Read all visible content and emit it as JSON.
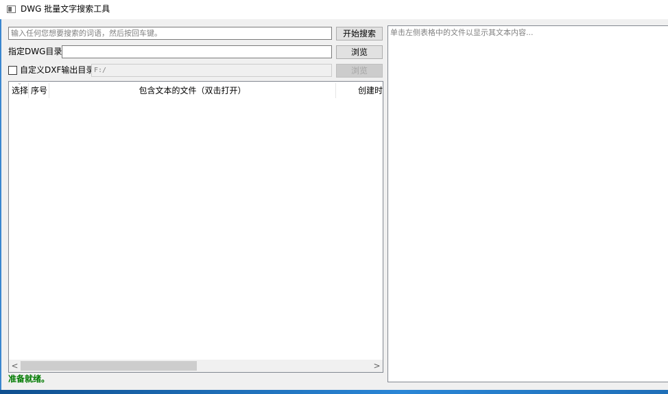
{
  "window": {
    "title": "DWG 批量文字搜索工具"
  },
  "search": {
    "placeholder": "输入任何您想要搜索的词语，然后按回车键。",
    "button_label": "开始搜索"
  },
  "dwg_dir": {
    "label": "指定DWG目录:",
    "value": "",
    "browse_label": "浏览"
  },
  "dxf_dir": {
    "checkbox_label": "自定义DXF输出目录",
    "checked": false,
    "value": "F:/",
    "browse_label": "浏览"
  },
  "table": {
    "columns": [
      "选择",
      "序号",
      "包含文本的文件（双击打开）",
      "创建时"
    ],
    "rows": []
  },
  "preview": {
    "placeholder": "单击左侧表格中的文件以显示其文本内容..."
  },
  "status": {
    "text": "准备就绪。",
    "color": "#007a00"
  },
  "colors": {
    "taskbar": "#1f6fb8"
  }
}
